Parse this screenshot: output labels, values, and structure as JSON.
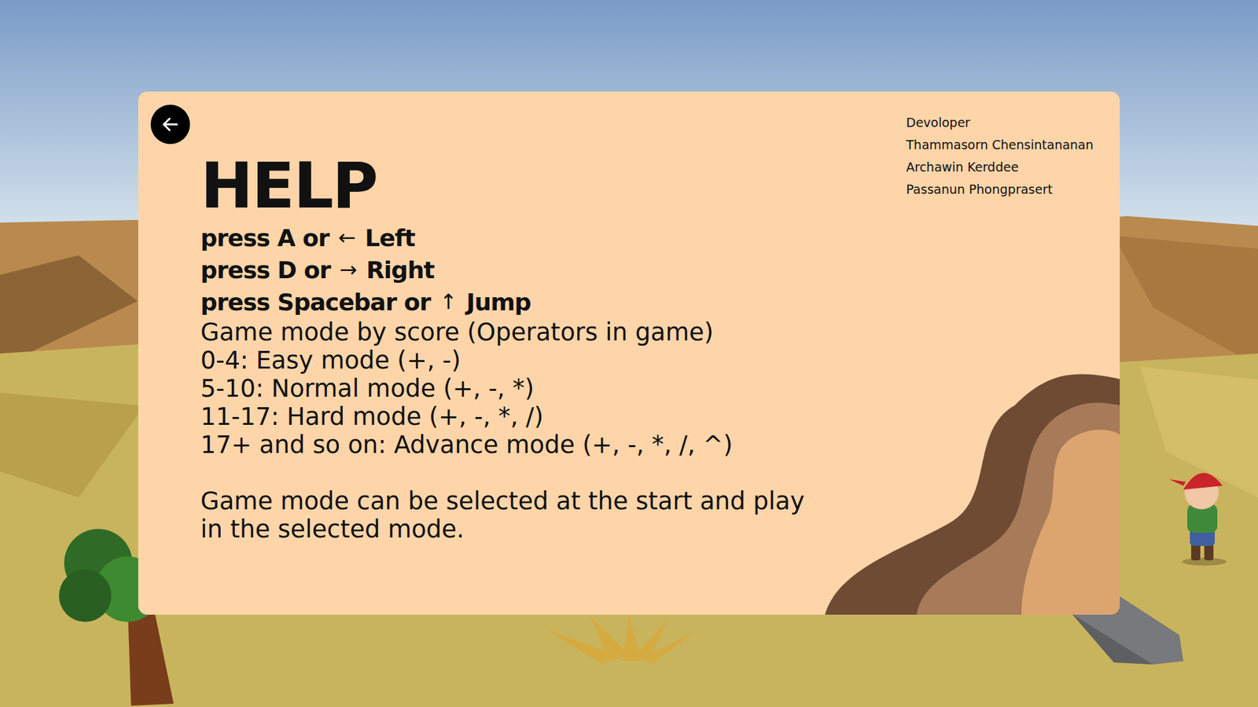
{
  "screen": {
    "title": "HELP"
  },
  "controls": [
    {
      "prefix": "press A or",
      "arrow": "←",
      "action": "Left"
    },
    {
      "prefix": "press D or",
      "arrow": "→",
      "action": "Right"
    },
    {
      "prefix": "press Spacebar or",
      "arrow": "↑",
      "action": "Jump"
    }
  ],
  "modes": {
    "heading": "Game mode by score (Operators in game)",
    "items": [
      "0-4: Easy mode (+, -)",
      "5-10: Normal mode (+, -, *)",
      "11-17: Hard mode (+, -, *, /)",
      "17+ and so on: Advance mode (+, -, *, /, ^)"
    ]
  },
  "note_lines": [
    "Game mode can be selected at the start and play",
    "in the selected mode."
  ],
  "credits": {
    "heading": "Devoloper",
    "names": [
      "Thammasorn Chensintananan",
      "Archawin Kerddee",
      "Passanun Phongprasert"
    ]
  }
}
